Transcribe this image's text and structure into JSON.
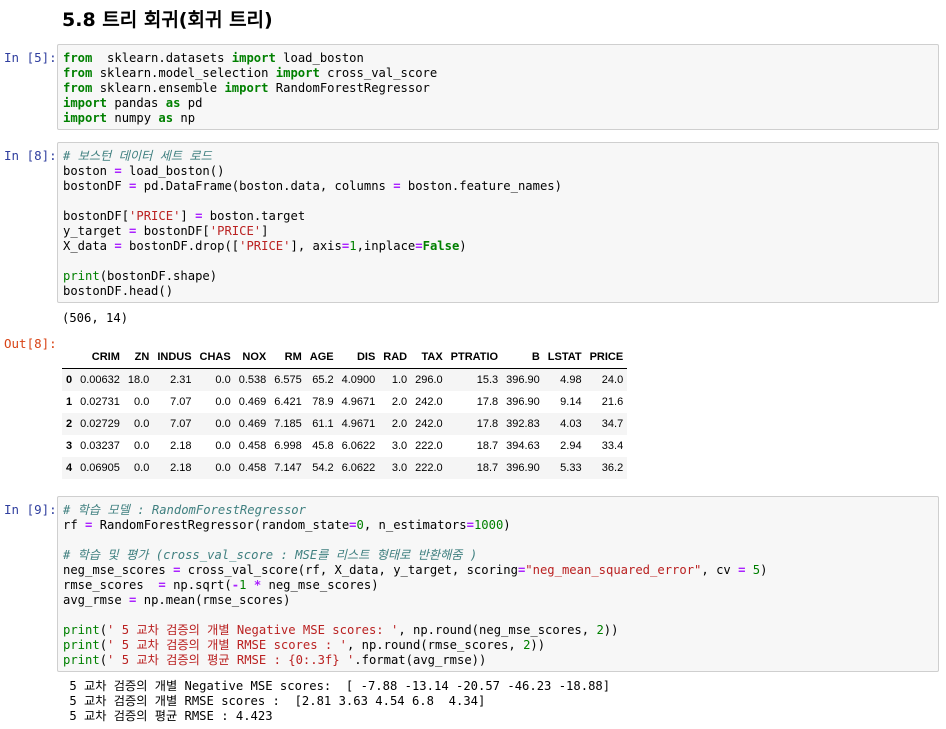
{
  "heading": "5.8 트리 회귀(회귀 트리)",
  "cells": [
    {
      "prompt": "In [5]:",
      "lines": [
        [
          [
            "kw",
            "from"
          ],
          [
            "",
            "  sklearn.datasets "
          ],
          [
            "kw",
            "import"
          ],
          [
            "",
            " load_boston"
          ]
        ],
        [
          [
            "kw",
            "from"
          ],
          [
            "",
            " sklearn.model_selection "
          ],
          [
            "kw",
            "import"
          ],
          [
            "",
            " cross_val_score"
          ]
        ],
        [
          [
            "kw",
            "from"
          ],
          [
            "",
            " sklearn.ensemble "
          ],
          [
            "kw",
            "import"
          ],
          [
            "",
            " RandomForestRegressor"
          ]
        ],
        [
          [
            "kw",
            "import"
          ],
          [
            "",
            " pandas "
          ],
          [
            "kw",
            "as"
          ],
          [
            "",
            " pd"
          ]
        ],
        [
          [
            "kw",
            "import"
          ],
          [
            "",
            " numpy "
          ],
          [
            "kw",
            "as"
          ],
          [
            "",
            " np"
          ]
        ]
      ]
    },
    {
      "prompt": "In [8]:",
      "lines": [
        [
          [
            "cm",
            "# 보스턴 데이터 세트 로드"
          ]
        ],
        [
          [
            "",
            "boston "
          ],
          [
            "op",
            "="
          ],
          [
            "",
            " load_boston()"
          ]
        ],
        [
          [
            "",
            "bostonDF "
          ],
          [
            "op",
            "="
          ],
          [
            "",
            " pd.DataFrame(boston.data, columns "
          ],
          [
            "op",
            "="
          ],
          [
            "",
            " boston.feature_names)"
          ]
        ],
        [
          [
            "",
            ""
          ]
        ],
        [
          [
            "",
            "bostonDF["
          ],
          [
            "st",
            "'PRICE'"
          ],
          [
            "",
            "] "
          ],
          [
            "op",
            "="
          ],
          [
            "",
            " boston.target"
          ]
        ],
        [
          [
            "",
            "y_target "
          ],
          [
            "op",
            "="
          ],
          [
            "",
            " bostonDF["
          ],
          [
            "st",
            "'PRICE'"
          ],
          [
            "",
            "]"
          ]
        ],
        [
          [
            "",
            "X_data "
          ],
          [
            "op",
            "="
          ],
          [
            "",
            " bostonDF.drop(["
          ],
          [
            "st",
            "'PRICE'"
          ],
          [
            "",
            "], axis"
          ],
          [
            "op",
            "="
          ],
          [
            "nu",
            "1"
          ],
          [
            "",
            ",inplace"
          ],
          [
            "op",
            "="
          ],
          [
            "kw",
            "False"
          ],
          [
            "",
            ")"
          ]
        ],
        [
          [
            "",
            ""
          ]
        ],
        [
          [
            "bi",
            "print"
          ],
          [
            "",
            "(bostonDF.shape)"
          ]
        ],
        [
          [
            "",
            "bostonDF.head()"
          ]
        ]
      ]
    },
    {
      "prompt": "In [9]:",
      "lines": [
        [
          [
            "cm",
            "# 학습 모델 : RandomForestRegressor"
          ]
        ],
        [
          [
            "",
            "rf "
          ],
          [
            "op",
            "="
          ],
          [
            "",
            " RandomForestRegressor(random_state"
          ],
          [
            "op",
            "="
          ],
          [
            "nu",
            "0"
          ],
          [
            "",
            ", n_estimators"
          ],
          [
            "op",
            "="
          ],
          [
            "nu",
            "1000"
          ],
          [
            "",
            ")"
          ]
        ],
        [
          [
            "",
            ""
          ]
        ],
        [
          [
            "cm",
            "# 학습 및 평가 (cross_val_score : MSE를 리스트 형태로 반환해줌 )"
          ]
        ],
        [
          [
            "",
            "neg_mse_scores "
          ],
          [
            "op",
            "="
          ],
          [
            "",
            " cross_val_score(rf, X_data, y_target, scoring"
          ],
          [
            "op",
            "="
          ],
          [
            "st",
            "\"neg_mean_squared_error\""
          ],
          [
            "",
            ", cv "
          ],
          [
            "op",
            "="
          ],
          [
            "",
            " "
          ],
          [
            "nu",
            "5"
          ],
          [
            "",
            ")"
          ]
        ],
        [
          [
            "",
            "rmse_scores  "
          ],
          [
            "op",
            "="
          ],
          [
            "",
            " np.sqrt("
          ],
          [
            "op",
            "-"
          ],
          [
            "nu",
            "1"
          ],
          [
            "",
            " "
          ],
          [
            "op",
            "*"
          ],
          [
            "",
            " neg_mse_scores)"
          ]
        ],
        [
          [
            "",
            "avg_rmse "
          ],
          [
            "op",
            "="
          ],
          [
            "",
            " np.mean(rmse_scores)"
          ]
        ],
        [
          [
            "",
            ""
          ]
        ],
        [
          [
            "bi",
            "print"
          ],
          [
            "",
            "("
          ],
          [
            "st",
            "' 5 교차 검증의 개별 Negative MSE scores: '"
          ],
          [
            "",
            ", np.round(neg_mse_scores, "
          ],
          [
            "nu",
            "2"
          ],
          [
            "",
            "))"
          ]
        ],
        [
          [
            "bi",
            "print"
          ],
          [
            "",
            "("
          ],
          [
            "st",
            "' 5 교차 검증의 개별 RMSE scores : '"
          ],
          [
            "",
            ", np.round(rmse_scores, "
          ],
          [
            "nu",
            "2"
          ],
          [
            "",
            "))"
          ]
        ],
        [
          [
            "bi",
            "print"
          ],
          [
            "",
            "("
          ],
          [
            "st",
            "' 5 교차 검증의 평균 RMSE : {0:.3f} '"
          ],
          [
            "",
            ".format(avg_rmse))"
          ]
        ]
      ]
    }
  ],
  "shape_output": "(506, 14)",
  "out_prompt": "Out[8]:",
  "table": {
    "columns": [
      "",
      "CRIM",
      "ZN",
      "INDUS",
      "CHAS",
      "NOX",
      "RM",
      "AGE",
      "DIS",
      "RAD",
      "TAX",
      "PTRATIO",
      "B",
      "LSTAT",
      "PRICE"
    ],
    "rows": [
      [
        "0",
        "0.00632",
        "18.0",
        "2.31",
        "0.0",
        "0.538",
        "6.575",
        "65.2",
        "4.0900",
        "1.0",
        "296.0",
        "15.3",
        "396.90",
        "4.98",
        "24.0"
      ],
      [
        "1",
        "0.02731",
        "0.0",
        "7.07",
        "0.0",
        "0.469",
        "6.421",
        "78.9",
        "4.9671",
        "2.0",
        "242.0",
        "17.8",
        "396.90",
        "9.14",
        "21.6"
      ],
      [
        "2",
        "0.02729",
        "0.0",
        "7.07",
        "0.0",
        "0.469",
        "7.185",
        "61.1",
        "4.9671",
        "2.0",
        "242.0",
        "17.8",
        "392.83",
        "4.03",
        "34.7"
      ],
      [
        "3",
        "0.03237",
        "0.0",
        "2.18",
        "0.0",
        "0.458",
        "6.998",
        "45.8",
        "6.0622",
        "3.0",
        "222.0",
        "18.7",
        "394.63",
        "2.94",
        "33.4"
      ],
      [
        "4",
        "0.06905",
        "0.0",
        "2.18",
        "0.0",
        "0.458",
        "7.147",
        "54.2",
        "6.0622",
        "3.0",
        "222.0",
        "18.7",
        "396.90",
        "5.33",
        "36.2"
      ]
    ]
  },
  "final_output": [
    " 5 교차 검증의 개별 Negative MSE scores:  [ -7.88 -13.14 -20.57 -46.23 -18.88]",
    " 5 교차 검증의 개별 RMSE scores :  [2.81 3.63 4.54 6.8  4.34]",
    " 5 교차 검증의 평균 RMSE : 4.423 "
  ]
}
